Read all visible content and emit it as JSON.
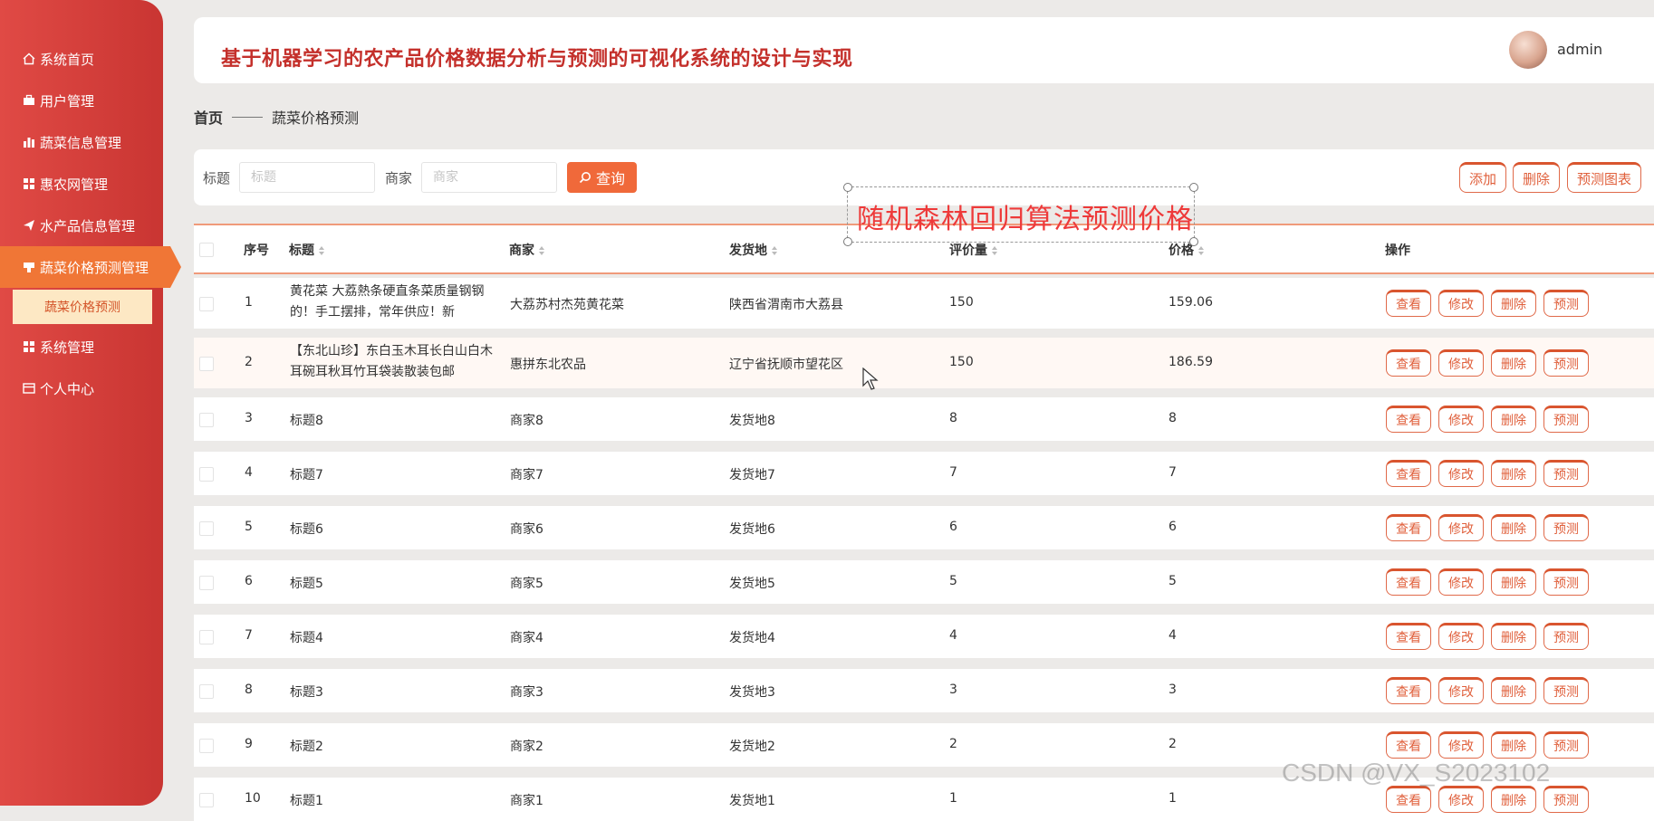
{
  "sidebar": {
    "items": [
      {
        "label": "系统首页",
        "icon": "home-icon"
      },
      {
        "label": "用户管理",
        "icon": "briefcase-icon"
      },
      {
        "label": "蔬菜信息管理",
        "icon": "bar-chart-icon"
      },
      {
        "label": "惠农网管理",
        "icon": "grid-icon"
      },
      {
        "label": "水产品信息管理",
        "icon": "send-icon"
      },
      {
        "label": "蔬菜价格预测管理",
        "icon": "cup-icon"
      },
      {
        "label": "系统管理",
        "icon": "grid-icon"
      },
      {
        "label": "个人中心",
        "icon": "card-icon"
      }
    ],
    "submenu": "蔬菜价格预测"
  },
  "header": {
    "title": "基于机器学习的农产品价格数据分析与预测的可视化系统的设计与实现",
    "username": "admin"
  },
  "breadcrumb": {
    "home": "首页",
    "current": "蔬菜价格预测"
  },
  "search": {
    "title_label": "标题",
    "title_placeholder": "标题",
    "merchant_label": "商家",
    "merchant_placeholder": "商家",
    "query_label": "查询"
  },
  "toolbar": {
    "add": "添加",
    "delete": "删除",
    "chart": "预测图表"
  },
  "annotation": "随机森林回归算法预测价格",
  "table": {
    "columns": {
      "index": "序号",
      "title": "标题",
      "merchant": "商家",
      "origin": "发货地",
      "reviews": "评价量",
      "price": "价格",
      "actions": "操作"
    },
    "action_labels": {
      "view": "查看",
      "edit": "修改",
      "delete": "删除",
      "predict": "预测"
    },
    "rows": [
      {
        "index": "1",
        "title_line1": "黄花菜 大荔熱条硬直条菜质量钢钢",
        "title_line2": "的！手工摆排，常年供应！新",
        "merchant": "大荔苏村杰苑黄花菜",
        "origin": "陕西省渭南市大荔县",
        "reviews": "150",
        "price": "159.06"
      },
      {
        "index": "2",
        "title_line1": "【东北山珍】东白玉木耳长白山白木",
        "title_line2": "耳碗耳秋耳竹耳袋装散装包邮",
        "merchant": "惠拼东北农品",
        "origin": "辽宁省抚顺市望花区",
        "reviews": "150",
        "price": "186.59"
      },
      {
        "index": "3",
        "title_line1": "标题8",
        "title_line2": "",
        "merchant": "商家8",
        "origin": "发货地8",
        "reviews": "8",
        "price": "8"
      },
      {
        "index": "4",
        "title_line1": "标题7",
        "title_line2": "",
        "merchant": "商家7",
        "origin": "发货地7",
        "reviews": "7",
        "price": "7"
      },
      {
        "index": "5",
        "title_line1": "标题6",
        "title_line2": "",
        "merchant": "商家6",
        "origin": "发货地6",
        "reviews": "6",
        "price": "6"
      },
      {
        "index": "6",
        "title_line1": "标题5",
        "title_line2": "",
        "merchant": "商家5",
        "origin": "发货地5",
        "reviews": "5",
        "price": "5"
      },
      {
        "index": "7",
        "title_line1": "标题4",
        "title_line2": "",
        "merchant": "商家4",
        "origin": "发货地4",
        "reviews": "4",
        "price": "4"
      },
      {
        "index": "8",
        "title_line1": "标题3",
        "title_line2": "",
        "merchant": "商家3",
        "origin": "发货地3",
        "reviews": "3",
        "price": "3"
      },
      {
        "index": "9",
        "title_line1": "标题2",
        "title_line2": "",
        "merchant": "商家2",
        "origin": "发货地2",
        "reviews": "2",
        "price": "2"
      },
      {
        "index": "10",
        "title_line1": "标题1",
        "title_line2": "",
        "merchant": "商家1",
        "origin": "发货地1",
        "reviews": "1",
        "price": "1"
      }
    ]
  },
  "watermark": "CSDN @VX_S2023102"
}
